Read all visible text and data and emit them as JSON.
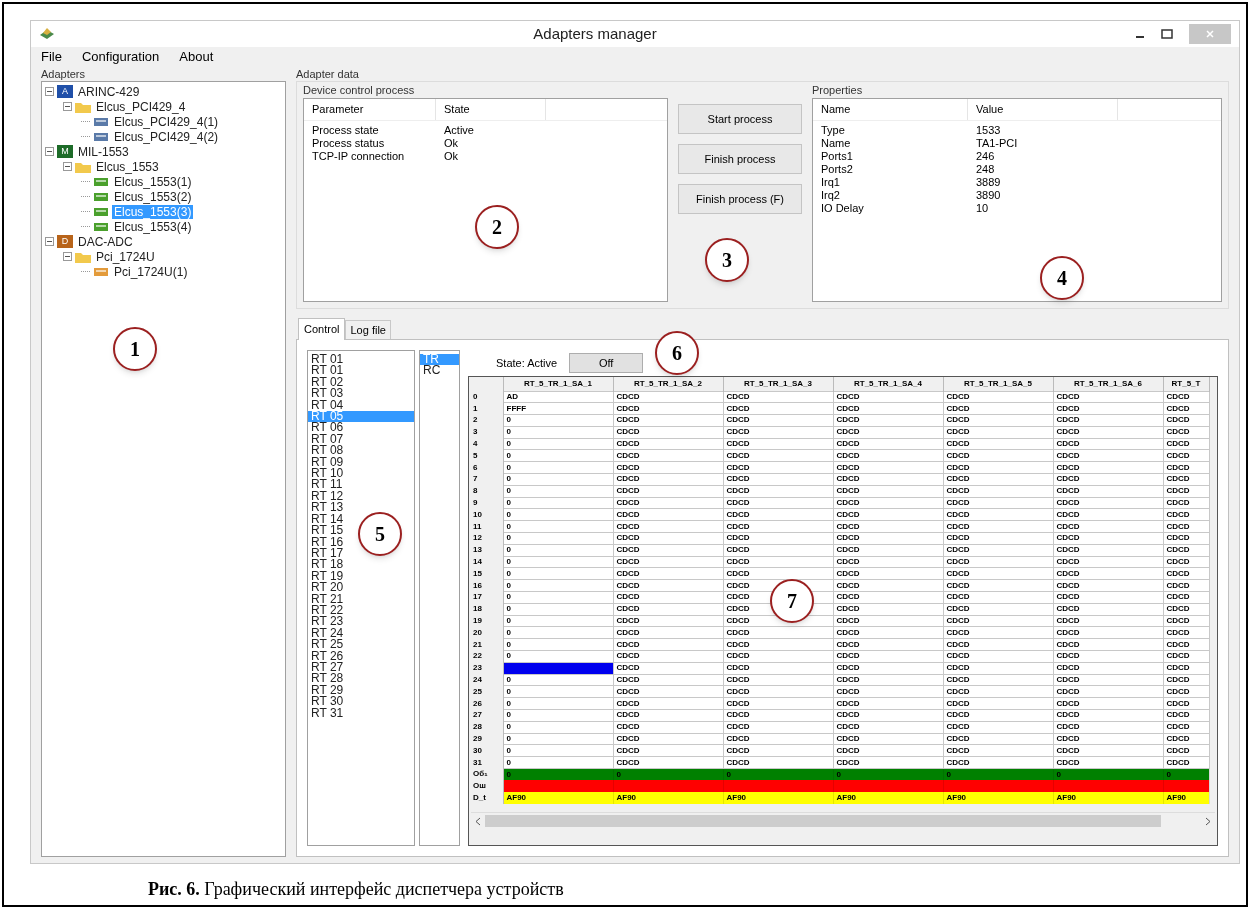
{
  "window": {
    "title": "Adapters manager"
  },
  "menu": [
    "File",
    "Configuration",
    "About"
  ],
  "adapters": {
    "title": "Adapters",
    "tree": [
      {
        "label": "ARINC-429",
        "kind": "bus",
        "badge": "A",
        "expanded": true,
        "selected": false,
        "children": [
          {
            "label": "Elcus_PCI429_4",
            "kind": "board",
            "expanded": true,
            "selected": false,
            "children": [
              {
                "label": "Elcus_PCI429_4(1)",
                "kind": "card",
                "selected": false
              },
              {
                "label": "Elcus_PCI429_4(2)",
                "kind": "card",
                "selected": false
              }
            ]
          }
        ]
      },
      {
        "label": "MIL-1553",
        "kind": "bus",
        "badge": "M",
        "expanded": true,
        "selected": false,
        "children": [
          {
            "label": "Elcus_1553",
            "kind": "board",
            "expanded": true,
            "selected": false,
            "children": [
              {
                "label": "Elcus_1553(1)",
                "kind": "channel",
                "selected": false
              },
              {
                "label": "Elcus_1553(2)",
                "kind": "channel",
                "selected": false
              },
              {
                "label": "Elcus_1553(3)",
                "kind": "channel",
                "selected": true
              },
              {
                "label": "Elcus_1553(4)",
                "kind": "channel",
                "selected": false
              }
            ]
          }
        ]
      },
      {
        "label": "DAC-ADC",
        "kind": "bus",
        "badge": "D",
        "expanded": true,
        "selected": false,
        "children": [
          {
            "label": "Pci_1724U",
            "kind": "board",
            "expanded": true,
            "selected": false,
            "children": [
              {
                "label": "Pci_1724U(1)",
                "kind": "io",
                "selected": false
              }
            ]
          }
        ]
      }
    ]
  },
  "adapter_data": {
    "title": "Adapter data",
    "device_control": {
      "title": "Device control process",
      "columns": [
        "Parameter",
        "State"
      ],
      "rows": [
        [
          "Process state",
          "Active"
        ],
        [
          "Process status",
          "Ok"
        ],
        [
          "TCP-IP connection",
          "Ok"
        ]
      ]
    },
    "buttons": [
      "Start process",
      "Finish process",
      "Finish process (F)"
    ],
    "properties": {
      "title": "Properties",
      "columns": [
        "Name",
        "Value"
      ],
      "rows": [
        [
          "Type",
          "1533"
        ],
        [
          "Name",
          "TA1-PCI"
        ],
        [
          "Ports1",
          "246"
        ],
        [
          "Ports2",
          "248"
        ],
        [
          "Irq1",
          "3889"
        ],
        [
          "Irq2",
          "3890"
        ],
        [
          "IO Delay",
          "10"
        ]
      ]
    }
  },
  "tabs": [
    {
      "label": "Control",
      "selected": true
    },
    {
      "label": "Log file",
      "selected": false
    }
  ],
  "control": {
    "rt_list": [
      {
        "label": "RT 01",
        "selected": false
      },
      {
        "label": "RT 01",
        "selected": false
      },
      {
        "label": "RT 02",
        "selected": false
      },
      {
        "label": "RT 03",
        "selected": false
      },
      {
        "label": "RT 04",
        "selected": false
      },
      {
        "label": "RT 05",
        "selected": true
      },
      {
        "label": "RT 06",
        "selected": false
      },
      {
        "label": "RT 07",
        "selected": false
      },
      {
        "label": "RT 08",
        "selected": false
      },
      {
        "label": "RT 09",
        "selected": false
      },
      {
        "label": "RT 10",
        "selected": false
      },
      {
        "label": "RT 11",
        "selected": false
      },
      {
        "label": "RT 12",
        "selected": false
      },
      {
        "label": "RT 13",
        "selected": false
      },
      {
        "label": "RT 14",
        "selected": false
      },
      {
        "label": "RT 15",
        "selected": false
      },
      {
        "label": "RT 16",
        "selected": false
      },
      {
        "label": "RT 17",
        "selected": false
      },
      {
        "label": "RT 18",
        "selected": false
      },
      {
        "label": "RT 19",
        "selected": false
      },
      {
        "label": "RT 20",
        "selected": false
      },
      {
        "label": "RT 21",
        "selected": false
      },
      {
        "label": "RT 22",
        "selected": false
      },
      {
        "label": "RT 23",
        "selected": false
      },
      {
        "label": "RT 24",
        "selected": false
      },
      {
        "label": "RT 25",
        "selected": false
      },
      {
        "label": "RT 26",
        "selected": false
      },
      {
        "label": "RT 27",
        "selected": false
      },
      {
        "label": "RT 28",
        "selected": false
      },
      {
        "label": "RT 29",
        "selected": false
      },
      {
        "label": "RT 30",
        "selected": false
      },
      {
        "label": "RT 31",
        "selected": false
      }
    ],
    "mode_list": [
      {
        "label": "TR",
        "selected": true
      },
      {
        "label": "RC",
        "selected": false
      }
    ],
    "state": "State: Active",
    "toggle_button": "Off",
    "grid": {
      "columns": [
        "RT_5_TR_1_SA_1",
        "RT_5_TR_1_SA_2",
        "RT_5_TR_1_SA_3",
        "RT_5_TR_1_SA_4",
        "RT_5_TR_1_SA_5",
        "RT_5_TR_1_SA_6",
        "RT_5_T"
      ],
      "rows": [
        {
          "label": "0",
          "kind": "data",
          "selected": false,
          "cells": [
            "AD",
            "CDCD",
            "CDCD",
            "CDCD",
            "CDCD",
            "CDCD",
            "CDCD"
          ]
        },
        {
          "label": "1",
          "kind": "data",
          "selected": false,
          "cells": [
            "FFFF",
            "CDCD",
            "CDCD",
            "CDCD",
            "CDCD",
            "CDCD",
            "CDCD"
          ]
        },
        {
          "label": "2",
          "kind": "data",
          "selected": false,
          "cells": [
            "0",
            "CDCD",
            "CDCD",
            "CDCD",
            "CDCD",
            "CDCD",
            "CDCD"
          ]
        },
        {
          "label": "3",
          "kind": "data",
          "selected": false,
          "cells": [
            "0",
            "CDCD",
            "CDCD",
            "CDCD",
            "CDCD",
            "CDCD",
            "CDCD"
          ]
        },
        {
          "label": "4",
          "kind": "data",
          "selected": false,
          "cells": [
            "0",
            "CDCD",
            "CDCD",
            "CDCD",
            "CDCD",
            "CDCD",
            "CDCD"
          ]
        },
        {
          "label": "5",
          "kind": "data",
          "selected": false,
          "cells": [
            "0",
            "CDCD",
            "CDCD",
            "CDCD",
            "CDCD",
            "CDCD",
            "CDCD"
          ]
        },
        {
          "label": "6",
          "kind": "data",
          "selected": false,
          "cells": [
            "0",
            "CDCD",
            "CDCD",
            "CDCD",
            "CDCD",
            "CDCD",
            "CDCD"
          ]
        },
        {
          "label": "7",
          "kind": "data",
          "selected": false,
          "cells": [
            "0",
            "CDCD",
            "CDCD",
            "CDCD",
            "CDCD",
            "CDCD",
            "CDCD"
          ]
        },
        {
          "label": "8",
          "kind": "data",
          "selected": false,
          "cells": [
            "0",
            "CDCD",
            "CDCD",
            "CDCD",
            "CDCD",
            "CDCD",
            "CDCD"
          ]
        },
        {
          "label": "9",
          "kind": "data",
          "selected": false,
          "cells": [
            "0",
            "CDCD",
            "CDCD",
            "CDCD",
            "CDCD",
            "CDCD",
            "CDCD"
          ]
        },
        {
          "label": "10",
          "kind": "data",
          "selected": false,
          "cells": [
            "0",
            "CDCD",
            "CDCD",
            "CDCD",
            "CDCD",
            "CDCD",
            "CDCD"
          ]
        },
        {
          "label": "11",
          "kind": "data",
          "selected": false,
          "cells": [
            "0",
            "CDCD",
            "CDCD",
            "CDCD",
            "CDCD",
            "CDCD",
            "CDCD"
          ]
        },
        {
          "label": "12",
          "kind": "data",
          "selected": false,
          "cells": [
            "0",
            "CDCD",
            "CDCD",
            "CDCD",
            "CDCD",
            "CDCD",
            "CDCD"
          ]
        },
        {
          "label": "13",
          "kind": "data",
          "selected": false,
          "cells": [
            "0",
            "CDCD",
            "CDCD",
            "CDCD",
            "CDCD",
            "CDCD",
            "CDCD"
          ]
        },
        {
          "label": "14",
          "kind": "data",
          "selected": false,
          "cells": [
            "0",
            "CDCD",
            "CDCD",
            "CDCD",
            "CDCD",
            "CDCD",
            "CDCD"
          ]
        },
        {
          "label": "15",
          "kind": "data",
          "selected": false,
          "cells": [
            "0",
            "CDCD",
            "CDCD",
            "CDCD",
            "CDCD",
            "CDCD",
            "CDCD"
          ]
        },
        {
          "label": "16",
          "kind": "data",
          "selected": false,
          "cells": [
            "0",
            "CDCD",
            "CDCD",
            "CDCD",
            "CDCD",
            "CDCD",
            "CDCD"
          ]
        },
        {
          "label": "17",
          "kind": "data",
          "selected": false,
          "cells": [
            "0",
            "CDCD",
            "CDCD",
            "CDCD",
            "CDCD",
            "CDCD",
            "CDCD"
          ]
        },
        {
          "label": "18",
          "kind": "data",
          "selected": false,
          "cells": [
            "0",
            "CDCD",
            "CDCD",
            "CDCD",
            "CDCD",
            "CDCD",
            "CDCD"
          ]
        },
        {
          "label": "19",
          "kind": "data",
          "selected": false,
          "cells": [
            "0",
            "CDCD",
            "CDCD",
            "CDCD",
            "CDCD",
            "CDCD",
            "CDCD"
          ]
        },
        {
          "label": "20",
          "kind": "data",
          "selected": false,
          "cells": [
            "0",
            "CDCD",
            "CDCD",
            "CDCD",
            "CDCD",
            "CDCD",
            "CDCD"
          ]
        },
        {
          "label": "21",
          "kind": "data",
          "selected": false,
          "cells": [
            "0",
            "CDCD",
            "CDCD",
            "CDCD",
            "CDCD",
            "CDCD",
            "CDCD"
          ]
        },
        {
          "label": "22",
          "kind": "data",
          "selected": false,
          "cells": [
            "0",
            "CDCD",
            "CDCD",
            "CDCD",
            "CDCD",
            "CDCD",
            "CDCD"
          ]
        },
        {
          "label": "23",
          "kind": "data",
          "selected": true,
          "cells": [
            null,
            "CDCD",
            "CDCD",
            "CDCD",
            "CDCD",
            "CDCD",
            "CDCD"
          ]
        },
        {
          "label": "24",
          "kind": "data",
          "selected": false,
          "cells": [
            "0",
            "CDCD",
            "CDCD",
            "CDCD",
            "CDCD",
            "CDCD",
            "CDCD"
          ]
        },
        {
          "label": "25",
          "kind": "data",
          "selected": false,
          "cells": [
            "0",
            "CDCD",
            "CDCD",
            "CDCD",
            "CDCD",
            "CDCD",
            "CDCD"
          ]
        },
        {
          "label": "26",
          "kind": "data",
          "selected": false,
          "cells": [
            "0",
            "CDCD",
            "CDCD",
            "CDCD",
            "CDCD",
            "CDCD",
            "CDCD"
          ]
        },
        {
          "label": "27",
          "kind": "data",
          "selected": false,
          "cells": [
            "0",
            "CDCD",
            "CDCD",
            "CDCD",
            "CDCD",
            "CDCD",
            "CDCD"
          ]
        },
        {
          "label": "28",
          "kind": "data",
          "selected": false,
          "cells": [
            "0",
            "CDCD",
            "CDCD",
            "CDCD",
            "CDCD",
            "CDCD",
            "CDCD"
          ]
        },
        {
          "label": "29",
          "kind": "data",
          "selected": false,
          "cells": [
            "0",
            "CDCD",
            "CDCD",
            "CDCD",
            "CDCD",
            "CDCD",
            "CDCD"
          ]
        },
        {
          "label": "30",
          "kind": "data",
          "selected": false,
          "cells": [
            "0",
            "CDCD",
            "CDCD",
            "CDCD",
            "CDCD",
            "CDCD",
            "CDCD"
          ]
        },
        {
          "label": "31",
          "kind": "data",
          "selected": false,
          "cells": [
            "0",
            "CDCD",
            "CDCD",
            "CDCD",
            "CDCD",
            "CDCD",
            "CDCD"
          ]
        },
        {
          "label": "Об₁",
          "kind": "status",
          "color": "#008000",
          "cells": [
            "0",
            "0",
            "0",
            "0",
            "0",
            "0",
            "0"
          ]
        },
        {
          "label": "Ош",
          "kind": "status",
          "color": "#ff0000"
        },
        {
          "label": "D_t",
          "kind": "status",
          "color": "#ffff00",
          "cells": [
            "AF90",
            "AF90",
            "AF90",
            "AF90",
            "AF90",
            "AF90",
            "AF90"
          ]
        }
      ]
    }
  },
  "callouts": [
    "1",
    "2",
    "3",
    "4",
    "5",
    "6",
    "7"
  ],
  "caption": "**Рис. 6.** Графический интерфейс диспетчера устройств"
}
